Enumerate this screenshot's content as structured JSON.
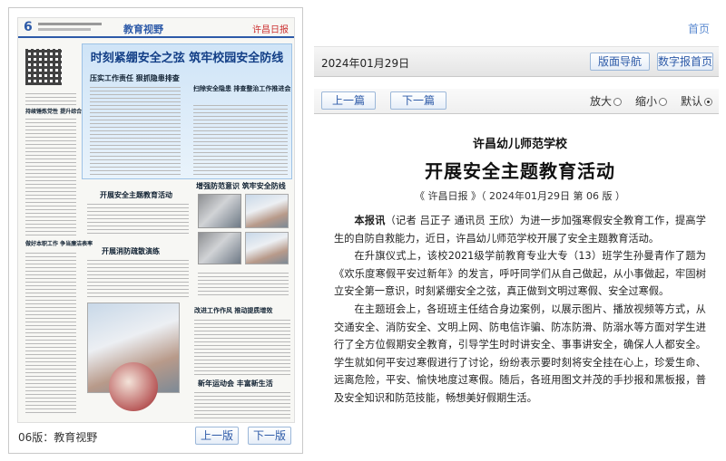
{
  "header": {
    "home_link": "首页"
  },
  "toolbar": {
    "date": "2024年01月29日",
    "layout_nav_label": "版面导航",
    "digital_home_label": "数字报首页",
    "prev_article_label": "上一篇",
    "next_article_label": "下一篇",
    "zoom_in_label": "放大",
    "zoom_out_label": "缩小",
    "default_label": "默认"
  },
  "page_panel": {
    "page_label": "06版：教育视野",
    "prev_page_label": "上一版",
    "next_page_label": "下一版",
    "thumbnail": {
      "page_number": "6",
      "section": "教育视野",
      "paper_logo": "许昌日报",
      "banner_title": "时刻紧绷安全之弦 筑牢校园安全防线",
      "headlines": [
        "压实工作责任 狠抓隐患排查",
        "扫除安全隐患 排查整治工作推进会",
        "持续锤炼党性 提升综合素质",
        "开展安全主题教育活动",
        "增强防范意识 筑牢安全防线",
        "开展消防疏散演练",
        "做好本职工作 争当廉洁表率",
        "改进工作作风 推动提质增效",
        "新年运动会 丰富新生活"
      ]
    }
  },
  "article": {
    "kicker": "许昌幼儿师范学校",
    "title": "开展安全主题教育活动",
    "source": "《 许昌日报 》（ 2024年01月29日 第 06 版 ）",
    "lead_label": "本报讯",
    "paragraphs": [
      "（记者 吕正子 通讯员 王欣）为进一步加强寒假安全教育工作，提高学生的自防自救能力，近日，许昌幼儿师范学校开展了安全主题教育活动。",
      "在升旗仪式上，该校2021级学前教育专业大专（13）班学生孙曼青作了题为《欢乐度寒假平安过新年》的发言，呼吁同学们从自己做起，从小事做起，牢固树立安全第一意识，时刻紧绷安全之弦，真正做到文明过寒假、安全过寒假。",
      "在主题班会上，各班班主任结合身边案例，以展示图片、播放视频等方式，从交通安全、消防安全、文明上网、防电信诈骗、防冻防滑、防溺水等方面对学生进行了全方位假期安全教育，引导学生时时讲安全、事事讲安全，确保人人都安全。学生就如何平安过寒假进行了讨论，纷纷表示要时刻将安全挂在心上，珍爱生命、远离危险，平安、愉快地度过寒假。随后，各班用图文并茂的手抄报和黑板报，普及安全知识和防范技能，畅想美好假期生活。"
    ]
  }
}
